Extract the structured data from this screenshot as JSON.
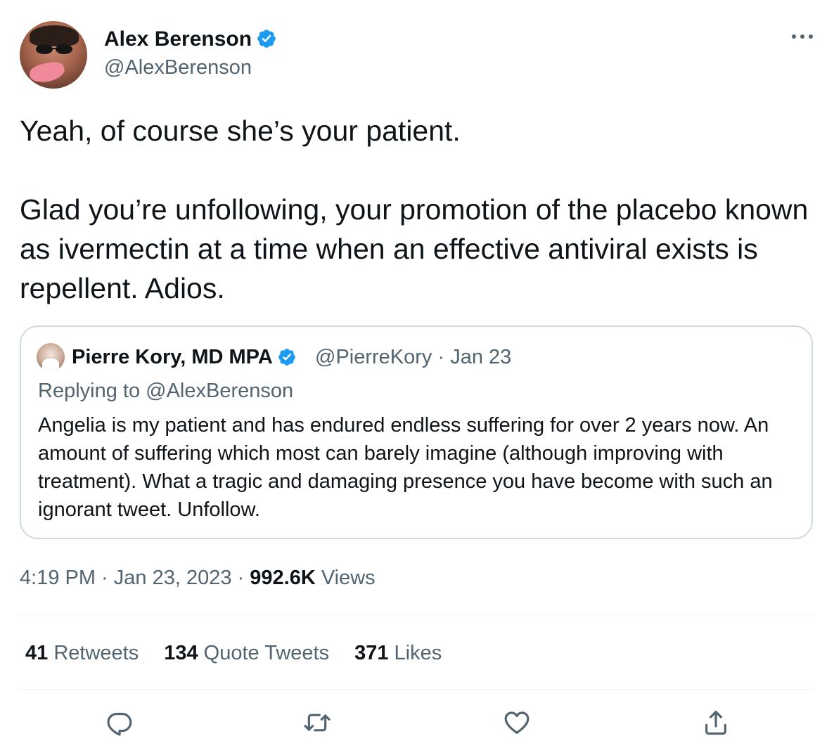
{
  "author": {
    "name": "Alex Berenson",
    "handle": "@AlexBerenson"
  },
  "tweet": {
    "text": "Yeah, of course she’s your patient.\n\nGlad you’re unfollowing, your promotion of the placebo known as ivermectin at a time when an effective antiviral exists is repellent. Adios."
  },
  "quoted": {
    "name": "Pierre Kory, MD MPA",
    "handle_date": "@PierreKory · Jan 23",
    "replying": "Replying to @AlexBerenson",
    "text": "Angelia is my patient and has endured endless suffering for over 2 years now. An amount of suffering which most can barely imagine (although improving with treatment). What a tragic and damaging presence you have become with such an ignorant tweet. Unfollow."
  },
  "meta": {
    "time": "4:19 PM",
    "sep1": " · ",
    "date": "Jan 23, 2023",
    "sep2": " · ",
    "views_count": "992.6K",
    "views_label": " Views"
  },
  "stats": {
    "retweets_count": "41",
    "retweets_label": " Retweets",
    "quotes_count": "134",
    "quotes_label": " Quote Tweets",
    "likes_count": "371",
    "likes_label": " Likes"
  },
  "colors": {
    "verified": "#1d9bf0",
    "secondary_text": "#536471",
    "primary_text": "#0f1419",
    "border": "#cfd9de"
  },
  "icons": {
    "more": "more-icon",
    "reply": "reply-icon",
    "retweet": "retweet-icon",
    "like": "heart-icon",
    "share": "share-icon"
  }
}
